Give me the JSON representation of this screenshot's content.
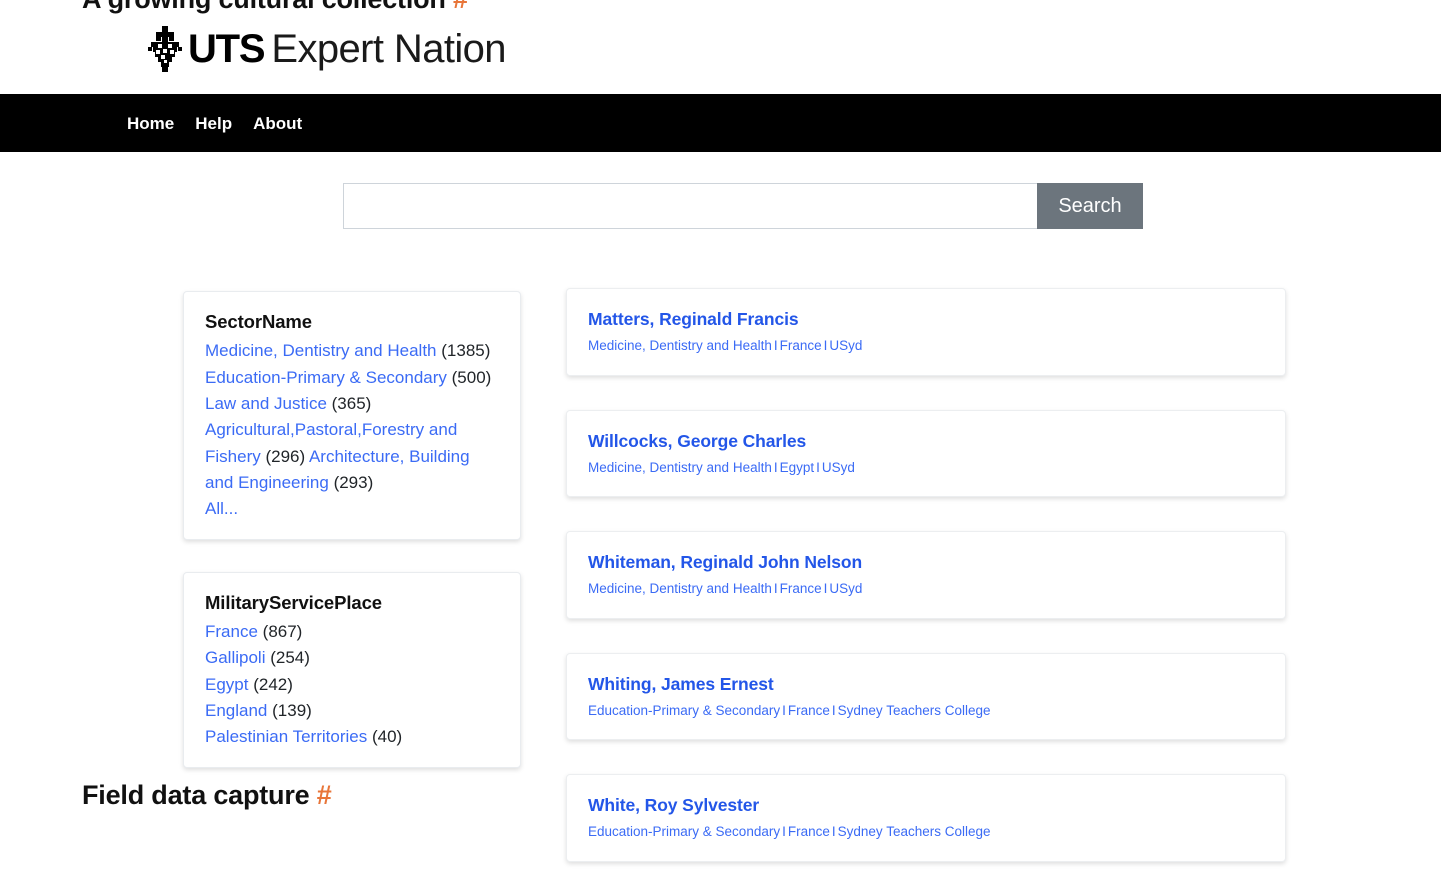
{
  "clipped_headings": {
    "top": {
      "text": "A growing cultural collection",
      "hash": "#"
    },
    "bottom": {
      "text": "Field data capture",
      "hash": "#"
    }
  },
  "brand": {
    "logo_icon": "uts-diamond-mark-icon",
    "uts": "UTS",
    "rest": "Expert Nation"
  },
  "nav": {
    "items": [
      {
        "label": "Home"
      },
      {
        "label": "Help"
      },
      {
        "label": "About"
      }
    ]
  },
  "search": {
    "value": "",
    "placeholder": "",
    "button_label": "Search"
  },
  "facets": [
    {
      "title": "SectorName",
      "items": [
        {
          "label": "Medicine, Dentistry and Health",
          "count": "(1385)"
        },
        {
          "label": "Education-Primary & Secondary",
          "count": "(500)"
        },
        {
          "label": "Law and Justice",
          "count": "(365)"
        },
        {
          "label": "Agricultural,Pastoral,Forestry and Fishery",
          "count": "(296)"
        },
        {
          "label": "Architecture, Building and Engineering",
          "count": "(293)"
        }
      ],
      "all_label": "All..."
    },
    {
      "title": "MilitaryServicePlace",
      "items": [
        {
          "label": "France",
          "count": "(867)"
        },
        {
          "label": "Gallipoli",
          "count": "(254)"
        },
        {
          "label": "Egypt",
          "count": "(242)"
        },
        {
          "label": "England",
          "count": "(139)"
        },
        {
          "label": "Palestinian Territories",
          "count": "(40)"
        }
      ],
      "all_label": ""
    }
  ],
  "results": [
    {
      "name": "Matters, Reginald Francis",
      "sector": "Medicine, Dentistry and Health",
      "place": "France",
      "institution": "USyd"
    },
    {
      "name": "Willcocks, George Charles",
      "sector": "Medicine, Dentistry and Health",
      "place": "Egypt",
      "institution": "USyd"
    },
    {
      "name": "Whiteman, Reginald John Nelson",
      "sector": "Medicine, Dentistry and Health",
      "place": "France",
      "institution": "USyd"
    },
    {
      "name": "Whiting, James Ernest",
      "sector": "Education-Primary & Secondary",
      "place": "France",
      "institution": "Sydney Teachers College"
    },
    {
      "name": "White, Roy Sylvester",
      "sector": "Education-Primary & Secondary",
      "place": "France",
      "institution": "Sydney Teachers College"
    }
  ],
  "separator": "I",
  "colors": {
    "link_blue": "#3b6bf5",
    "result_blue": "#2356e8",
    "navbar_black": "#000000",
    "search_button_gray": "#6c757d",
    "hash_orange": "#e8763a"
  }
}
